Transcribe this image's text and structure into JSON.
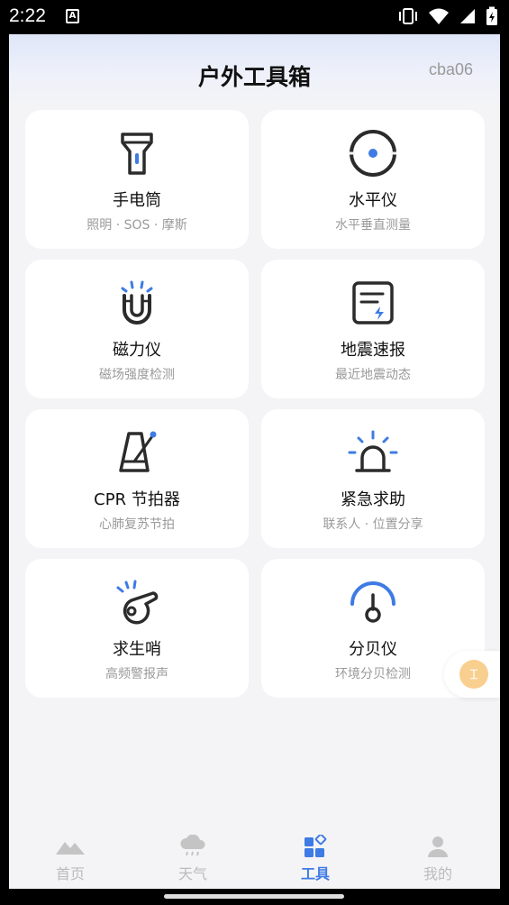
{
  "status": {
    "time": "2:22",
    "a_badge": "A"
  },
  "header": {
    "title": "户外工具箱",
    "user_code": "cba06"
  },
  "tools": {
    "flashlight": {
      "title": "手电筒",
      "desc": "照明 · SOS · 摩斯",
      "icon": "flashlight-icon"
    },
    "level": {
      "title": "水平仪",
      "desc": "水平垂直测量",
      "icon": "level-icon"
    },
    "magnetometer": {
      "title": "磁力仪",
      "desc": "磁场强度检测",
      "icon": "magnet-icon"
    },
    "earthquake": {
      "title": "地震速报",
      "desc": "最近地震动态",
      "icon": "earthquake-report-icon"
    },
    "cpr": {
      "title": "CPR 节拍器",
      "desc": "心肺复苏节拍",
      "icon": "metronome-icon"
    },
    "sos": {
      "title": "紧急求助",
      "desc": "联系人 · 位置分享",
      "icon": "alarm-light-icon"
    },
    "whistle": {
      "title": "求生哨",
      "desc": "高频警报声",
      "icon": "whistle-icon"
    },
    "decibel": {
      "title": "分贝仪",
      "desc": "环境分贝检测",
      "icon": "decibel-gauge-icon"
    }
  },
  "tabbar": {
    "home": "首页",
    "weather": "天气",
    "tools": "工具",
    "mine": "我的",
    "active": "tools"
  },
  "colors": {
    "accent": "#3e7be4",
    "icon_dark": "#2b2b2b",
    "muted": "#9a9a9a"
  }
}
